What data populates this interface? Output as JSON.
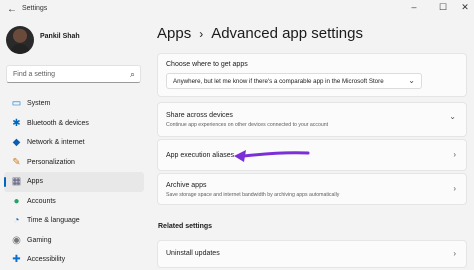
{
  "window": {
    "title": "Settings",
    "back_glyph": "←",
    "min_glyph": "–",
    "max_glyph": "☐",
    "close_glyph": "✕"
  },
  "profile": {
    "name": "Pankil Shah"
  },
  "search": {
    "placeholder": "Find a setting",
    "icon": "search-icon",
    "glyph": "⌕"
  },
  "nav": {
    "items": [
      {
        "label": "System",
        "icon": "monitor-icon",
        "glyph": "▭",
        "color": "#0078d4"
      },
      {
        "label": "Bluetooth & devices",
        "icon": "bluetooth-icon",
        "glyph": "✱",
        "color": "#0067c0"
      },
      {
        "label": "Network & internet",
        "icon": "wifi-icon",
        "glyph": "◆",
        "color": "#0a5fb4"
      },
      {
        "label": "Personalization",
        "icon": "brush-icon",
        "glyph": "✎",
        "color": "#d47a1b"
      },
      {
        "label": "Apps",
        "icon": "apps-icon",
        "glyph": "▦",
        "color": "#5a5a7a"
      },
      {
        "label": "Accounts",
        "icon": "person-icon",
        "glyph": "●",
        "color": "#22a36a"
      },
      {
        "label": "Time & language",
        "icon": "globe-clock-icon",
        "glyph": "◔",
        "color": "#1b6fc7"
      },
      {
        "label": "Gaming",
        "icon": "controller-icon",
        "glyph": "◉",
        "color": "#777"
      },
      {
        "label": "Accessibility",
        "icon": "accessibility-icon",
        "glyph": "✚",
        "color": "#0b6fd0"
      }
    ],
    "active_index": 4
  },
  "breadcrumb": {
    "parent": "Apps",
    "separator": "›",
    "current": "Advanced app settings"
  },
  "cards": {
    "get_apps": {
      "title": "Choose where to get apps",
      "dropdown_value": "Anywhere, but let me know if there's a comparable app in the Microsoft Store",
      "dropdown_glyph": "⌄"
    },
    "share": {
      "title": "Share across devices",
      "desc": "Continue app experiences on other devices connected to your account",
      "chevron": "⌄"
    },
    "aliases": {
      "title": "App execution aliases",
      "chevron": "›"
    },
    "archive": {
      "title": "Archive apps",
      "desc": "Save storage space and internet bandwidth by archiving apps automatically",
      "chevron": "›"
    }
  },
  "related": {
    "heading": "Related settings",
    "uninstall": {
      "title": "Uninstall updates",
      "chevron": "›"
    }
  },
  "annotation": {
    "arrow_color": "#7b2fd6"
  }
}
